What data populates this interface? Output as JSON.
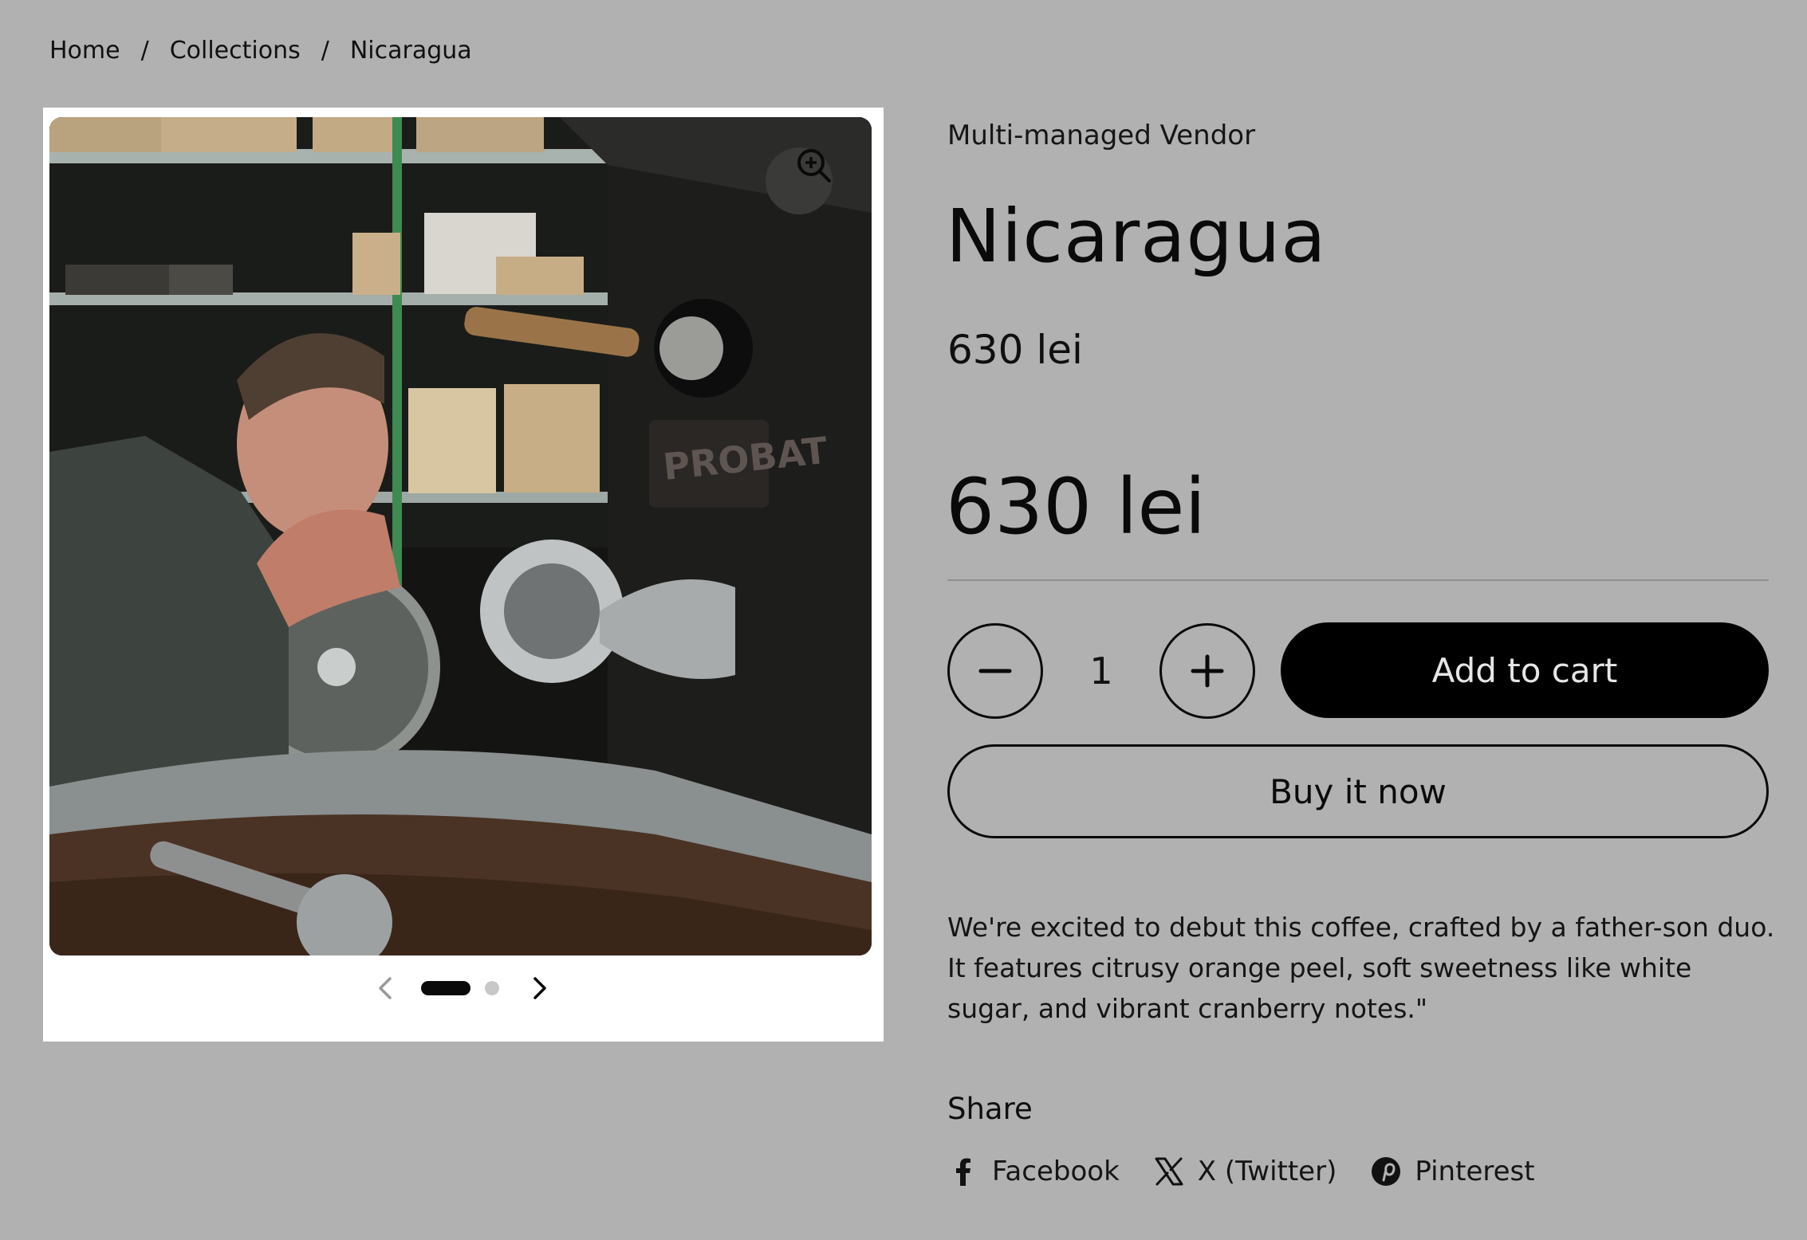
{
  "breadcrumb": {
    "items": [
      "Home",
      "Collections",
      "Nicaragua"
    ],
    "separator": "/"
  },
  "gallery": {
    "image_alt": "Man smelling coffee next to a PROBAT roaster",
    "roaster_brand_text": "PROBAT",
    "slide_count": 2,
    "active_slide": 1
  },
  "product": {
    "vendor": "Multi-managed Vendor",
    "title": "Nicaragua",
    "price": "630 lei",
    "price_large": "630 lei",
    "quantity": "1",
    "add_to_cart_label": "Add to cart",
    "buy_now_label": "Buy it now",
    "description": "We're excited to debut this coffee, crafted by a father-son duo. It features citrusy orange peel, soft sweetness like white sugar, and vibrant cranberry notes.\""
  },
  "share": {
    "title": "Share",
    "links": [
      {
        "label": "Facebook",
        "icon": "facebook-icon"
      },
      {
        "label": "X (Twitter)",
        "icon": "x-twitter-icon"
      },
      {
        "label": "Pinterest",
        "icon": "pinterest-icon"
      }
    ]
  },
  "colors": {
    "background": "#b1b1b1",
    "primary_button": "#000000",
    "primary_button_text": "#e6e6e6",
    "gallery_background": "#ffffff"
  }
}
